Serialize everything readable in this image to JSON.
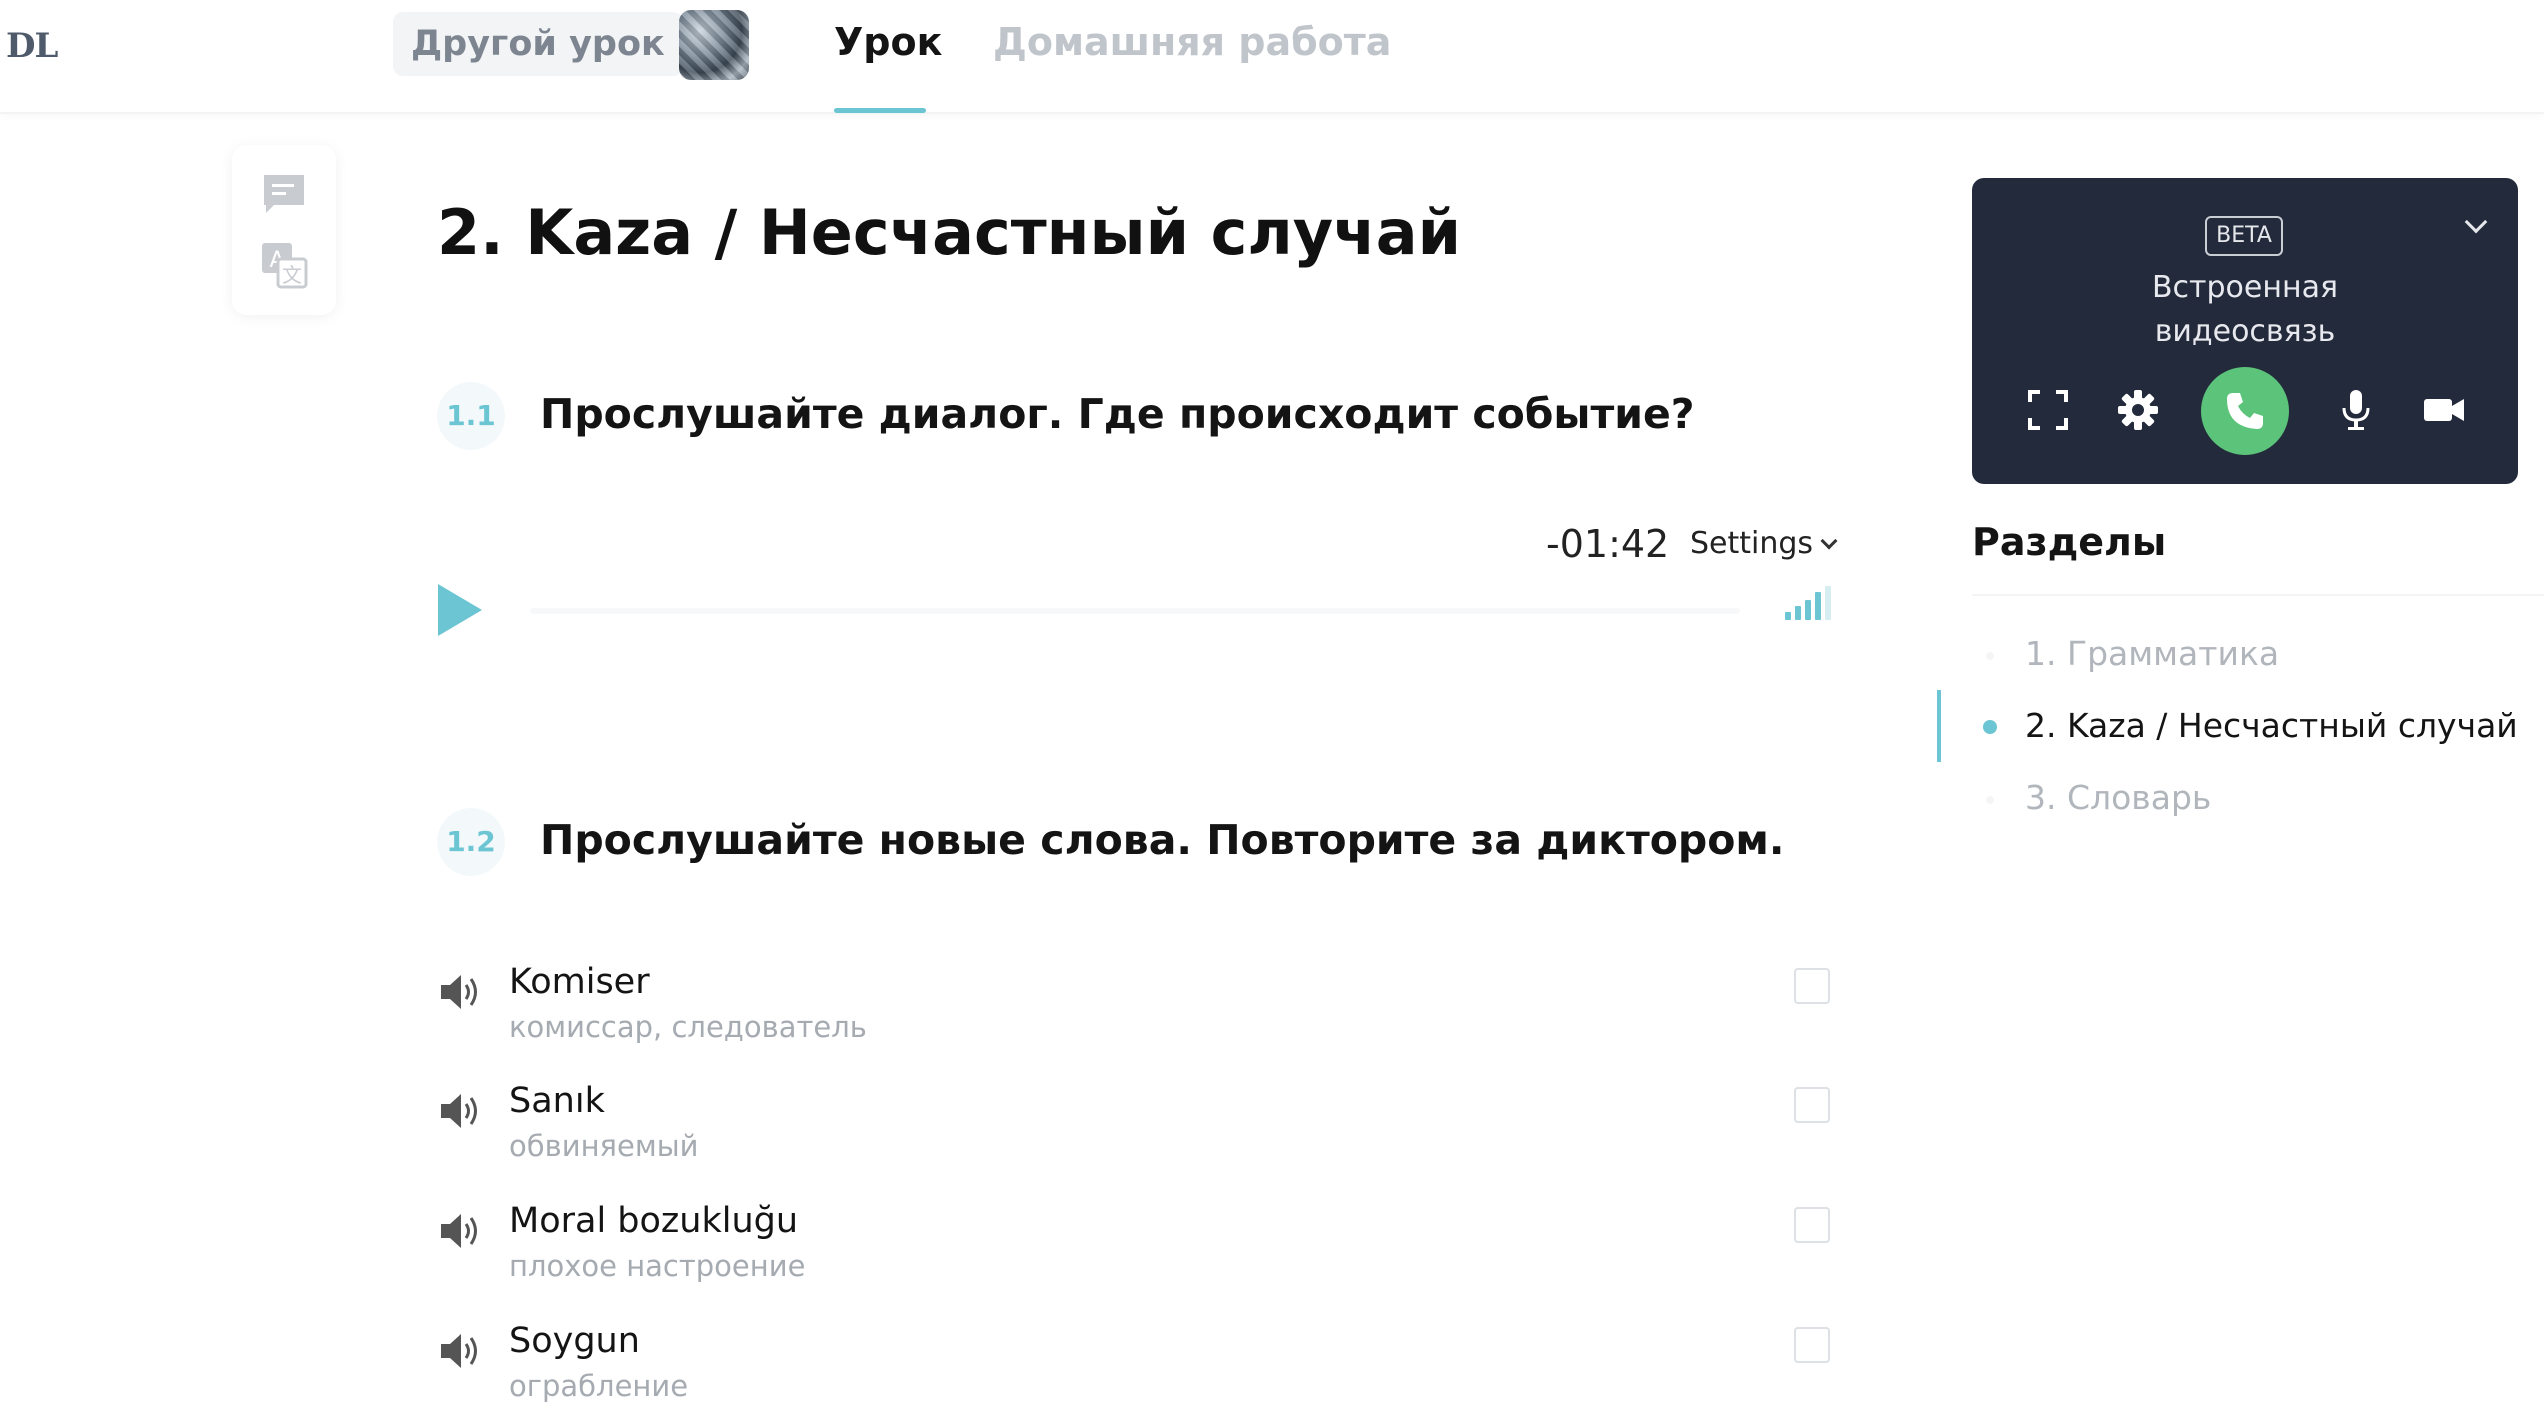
{
  "header": {
    "logo": "DL",
    "other_lesson": "Другой урок",
    "tabs": [
      {
        "label": "Урок",
        "active": true
      },
      {
        "label": "Домашняя работа",
        "active": false
      }
    ]
  },
  "tools": [
    {
      "icon": "comment-icon"
    },
    {
      "icon": "translate-icon"
    }
  ],
  "main": {
    "title": "2. Kaza / Несчастный случай",
    "sections": [
      {
        "number": "1.1",
        "title": "Прослушайте диалог. Где происходит событие?"
      },
      {
        "number": "1.2",
        "title": "Прослушайте новые слова. Повторите за диктором."
      }
    ],
    "player": {
      "time": "-01:42",
      "settings_label": "Settings",
      "progress": 0
    },
    "words": [
      {
        "word": "Komiser",
        "translation": "комиссар, следователь",
        "checked": false
      },
      {
        "word": "Sanık",
        "translation": "обвиняемый",
        "checked": false
      },
      {
        "word": "Moral bozukluğu",
        "translation": "плохое настроение",
        "checked": false
      },
      {
        "word": "Soygun",
        "translation": "ограбление",
        "checked": false
      }
    ]
  },
  "video_widget": {
    "badge": "BETA",
    "title_line1": "Встроенная",
    "title_line2": "видеосвязь",
    "buttons": [
      "fullscreen-icon",
      "gear-icon",
      "phone-icon",
      "microphone-icon",
      "camera-icon"
    ]
  },
  "sidebar": {
    "title": "Разделы",
    "items": [
      {
        "label": "1. Грамматика",
        "active": false
      },
      {
        "label": "2. Kaza / Несчастный случай",
        "active": true
      },
      {
        "label": "3. Словарь",
        "active": false
      }
    ]
  },
  "colors": {
    "accent": "#6cc5d3",
    "call_green": "#5cc37a",
    "video_bg": "#232a3b"
  }
}
